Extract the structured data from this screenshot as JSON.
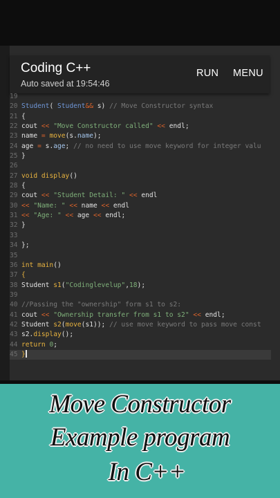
{
  "app": {
    "title": "Coding C++",
    "subtitle": "Auto saved at 19:54:46",
    "run_label": "RUN",
    "menu_label": "MENU"
  },
  "editor": {
    "active_line": 45,
    "lines": [
      {
        "n": "19",
        "seg": []
      },
      {
        "n": "20",
        "seg": [
          [
            "t",
            "Student"
          ],
          [
            "p",
            "( "
          ],
          [
            "t",
            "Student"
          ],
          [
            "op",
            "&&"
          ],
          [
            "p",
            " s) "
          ],
          [
            "c",
            "// Move Constructor syntax"
          ]
        ]
      },
      {
        "n": "21",
        "seg": [
          [
            "p",
            "{"
          ]
        ]
      },
      {
        "n": "22",
        "seg": [
          [
            "p",
            "cout "
          ],
          [
            "op",
            "<<"
          ],
          [
            "s",
            " \"Move Constructor called\" "
          ],
          [
            "op",
            "<<"
          ],
          [
            "p",
            " endl;"
          ]
        ]
      },
      {
        "n": "23",
        "seg": [
          [
            "p",
            "name "
          ],
          [
            "op",
            "="
          ],
          [
            "p",
            " "
          ],
          [
            "f",
            "move"
          ],
          [
            "p",
            "(s."
          ],
          [
            "n",
            "name"
          ],
          [
            "p",
            ");"
          ]
        ]
      },
      {
        "n": "24",
        "seg": [
          [
            "p",
            "age "
          ],
          [
            "op",
            "="
          ],
          [
            "p",
            " s."
          ],
          [
            "n",
            "age"
          ],
          [
            "p",
            "; "
          ],
          [
            "c",
            "// no need to use move keyword for integer valu"
          ]
        ]
      },
      {
        "n": "25",
        "seg": [
          [
            "p",
            "}"
          ]
        ]
      },
      {
        "n": "26",
        "seg": []
      },
      {
        "n": "27",
        "seg": [
          [
            "k",
            "void"
          ],
          [
            "p",
            " "
          ],
          [
            "f",
            "display"
          ],
          [
            "p",
            "()"
          ]
        ]
      },
      {
        "n": "28",
        "seg": [
          [
            "p",
            "{"
          ]
        ]
      },
      {
        "n": "29",
        "seg": [
          [
            "p",
            "cout "
          ],
          [
            "op",
            "<<"
          ],
          [
            "s",
            " \"Student Detail: \" "
          ],
          [
            "op",
            "<<"
          ],
          [
            "p",
            " endl"
          ]
        ]
      },
      {
        "n": "30",
        "seg": [
          [
            "op",
            "<<"
          ],
          [
            "s",
            " \"Name: \" "
          ],
          [
            "op",
            "<<"
          ],
          [
            "p",
            " name "
          ],
          [
            "op",
            "<<"
          ],
          [
            "p",
            " endl"
          ]
        ]
      },
      {
        "n": "31",
        "seg": [
          [
            "op",
            "<<"
          ],
          [
            "s",
            " \"Age: \" "
          ],
          [
            "op",
            "<<"
          ],
          [
            "p",
            " age "
          ],
          [
            "op",
            "<<"
          ],
          [
            "p",
            " endl;"
          ]
        ]
      },
      {
        "n": "32",
        "seg": [
          [
            "p",
            "}"
          ]
        ]
      },
      {
        "n": "33",
        "seg": []
      },
      {
        "n": "34",
        "seg": [
          [
            "p",
            "};"
          ]
        ]
      },
      {
        "n": "35",
        "seg": []
      },
      {
        "n": "36",
        "seg": [
          [
            "k",
            "int"
          ],
          [
            "p",
            " "
          ],
          [
            "f",
            "main"
          ],
          [
            "p",
            "()"
          ]
        ]
      },
      {
        "n": "37",
        "seg": [
          [
            "k",
            "{"
          ]
        ]
      },
      {
        "n": "38",
        "seg": [
          [
            "p",
            "Student "
          ],
          [
            "f",
            "s1"
          ],
          [
            "p",
            "("
          ],
          [
            "s",
            "\"Codinglevelup\""
          ],
          [
            "p",
            ","
          ],
          [
            "s",
            "18"
          ],
          [
            "p",
            ");"
          ]
        ]
      },
      {
        "n": "39",
        "seg": []
      },
      {
        "n": "40",
        "seg": [
          [
            "c",
            "//Passing the \"ownership\" form s1 to s2:"
          ]
        ]
      },
      {
        "n": "41",
        "seg": [
          [
            "p",
            "cout "
          ],
          [
            "op",
            "<<"
          ],
          [
            "s",
            " \"Ownership transfer from s1 to s2\" "
          ],
          [
            "op",
            "<<"
          ],
          [
            "p",
            " endl;"
          ]
        ]
      },
      {
        "n": "42",
        "seg": [
          [
            "p",
            "Student "
          ],
          [
            "f",
            "s2"
          ],
          [
            "p",
            "("
          ],
          [
            "f",
            "move"
          ],
          [
            "p",
            "(s1)); "
          ],
          [
            "c",
            "// use move keyword to pass move const"
          ]
        ]
      },
      {
        "n": "43",
        "seg": [
          [
            "p",
            "s2."
          ],
          [
            "f",
            "display"
          ],
          [
            "p",
            "();"
          ]
        ]
      },
      {
        "n": "44",
        "seg": [
          [
            "k",
            "return"
          ],
          [
            "p",
            " "
          ],
          [
            "s",
            "0"
          ],
          [
            "p",
            ";"
          ]
        ]
      },
      {
        "n": "45",
        "seg": [
          [
            "k",
            "}"
          ]
        ]
      }
    ]
  },
  "banner": {
    "line1": "Move Constructor",
    "line2": "Example program",
    "line3": "In C++"
  }
}
